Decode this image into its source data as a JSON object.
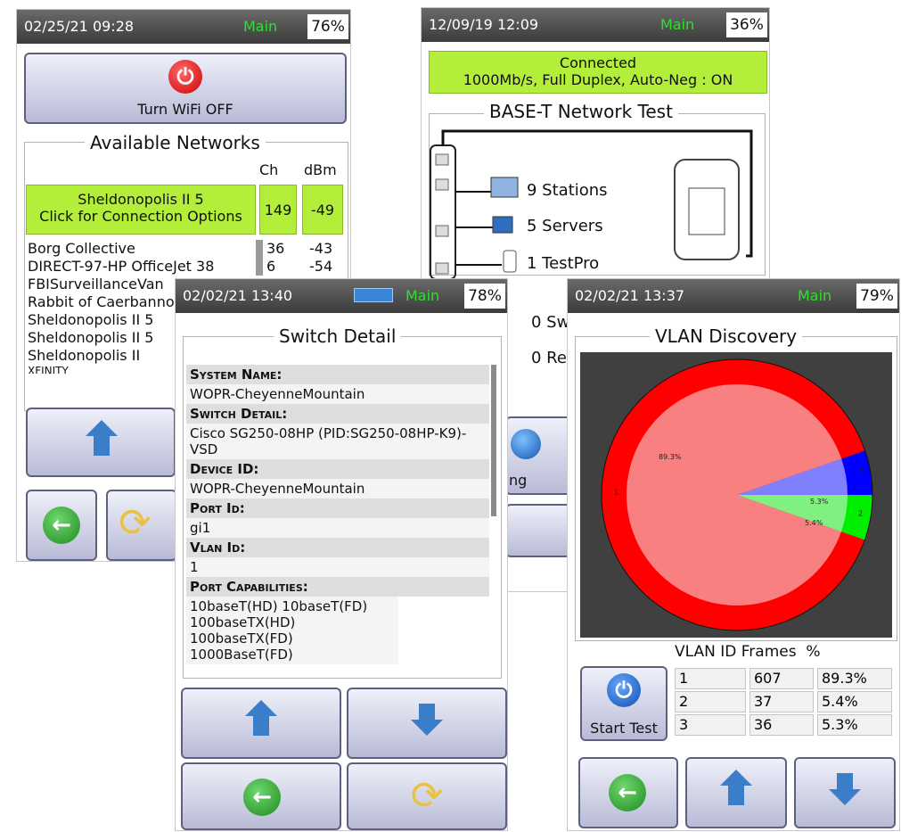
{
  "wifi": {
    "status": {
      "datetime": "02/25/21 09:28",
      "profile": "Main",
      "battery": "76%"
    },
    "toggle_label": "Turn WiFi OFF",
    "section_title": "Available Networks",
    "col_ch": "Ch",
    "col_dbm": "dBm",
    "selected": {
      "line1": "Sheldonopolis II 5",
      "line2": "Click for Connection Options",
      "ch": "149",
      "dbm": "-49"
    },
    "networks": [
      {
        "name": "Borg Collective",
        "ch": "36",
        "dbm": "-43"
      },
      {
        "name": "DIRECT-97-HP OfficeJet 38",
        "ch": "6",
        "dbm": "-54"
      },
      {
        "name": "FBISurveillanceVan",
        "ch": "",
        "dbm": ""
      },
      {
        "name": "Rabbit of Caerbannog",
        "ch": "",
        "dbm": ""
      },
      {
        "name": "Sheldonopolis II 5",
        "ch": "",
        "dbm": ""
      },
      {
        "name": "Sheldonopolis II 5",
        "ch": "",
        "dbm": ""
      },
      {
        "name": "Sheldonopolis II",
        "ch": "",
        "dbm": ""
      },
      {
        "name": "XFINITY",
        "ch": "",
        "dbm": ""
      }
    ]
  },
  "baset": {
    "status": {
      "datetime": "12/09/19 12:09",
      "profile": "Main",
      "battery": "36%"
    },
    "conn_line1": "Connected",
    "conn_line2": "1000Mb/s, Full Duplex, Auto-Neg : ON",
    "title": "BASE-T Network Test",
    "stations": "9 Stations",
    "servers": "5 Servers",
    "testpro": "1 TestPro",
    "switches": "0 Sw",
    "routers": "0 Re",
    "ping_label": "ng"
  },
  "switch": {
    "status": {
      "datetime": "02/02/21 13:40",
      "profile": "Main",
      "battery": "78%"
    },
    "title": "Switch Detail",
    "fields": [
      {
        "label": "System Name:",
        "value": "WOPR-CheyenneMountain"
      },
      {
        "label": "Switch Detail:",
        "value": "Cisco SG250-08HP (PID:SG250-08HP-K9)-VSD"
      },
      {
        "label": "Device ID:",
        "value": "WOPR-CheyenneMountain"
      },
      {
        "label": "Port Id:",
        "value": "gi1"
      },
      {
        "label": "Vlan Id:",
        "value": "1"
      },
      {
        "label": "Port Capabilities:",
        "value": "10baseT(HD) 10baseT(FD) 100baseTX(HD) 100baseTX(FD) 1000BaseT(FD)"
      }
    ]
  },
  "vlan": {
    "status": {
      "datetime": "02/02/21 13:37",
      "profile": "Main",
      "battery": "79%"
    },
    "title": "VLAN Discovery",
    "table_header": "VLAN ID Frames  %",
    "start_label": "Start Test",
    "rows": [
      {
        "id": "1",
        "frames": "607",
        "pct": "89.3%"
      },
      {
        "id": "2",
        "frames": "37",
        "pct": "5.4%"
      },
      {
        "id": "3",
        "frames": "36",
        "pct": "5.3%"
      }
    ],
    "colors": {
      "vlan1": "#ff0000",
      "vlan1_inner": "#f88080",
      "vlan2": "#00ee00",
      "vlan2_inner": "#80f080",
      "vlan3": "#0000ff",
      "vlan3_inner": "#8080ff",
      "plot_bg": "#404040"
    }
  },
  "chart_data": {
    "type": "pie",
    "categories": [
      "1",
      "2",
      "3"
    ],
    "values": [
      89.3,
      5.4,
      5.3
    ],
    "labels": [
      "89.3%",
      "5.4%",
      "5.3%"
    ]
  }
}
